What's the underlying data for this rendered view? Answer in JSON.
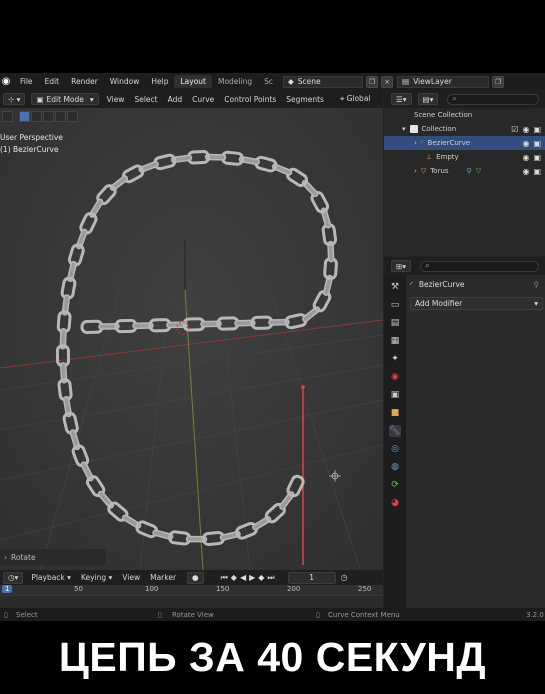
{
  "menubar": {
    "items": [
      "File",
      "Edit",
      "Render",
      "Window",
      "Help"
    ],
    "workspaces": [
      "Layout",
      "Modeling",
      "Sc"
    ],
    "scene": "Scene",
    "view_layer": "ViewLayer"
  },
  "viewport": {
    "mode": "Edit Mode",
    "menus": [
      "View",
      "Select",
      "Add",
      "Curve",
      "Control Points",
      "Segments"
    ],
    "transform_orientation": "Global",
    "perspective_label": "User Perspective",
    "object_label": "(1) BezierCurve",
    "last_operator": "Rotate"
  },
  "outliner": {
    "rows": [
      {
        "label": "Scene Collection",
        "selected": false
      },
      {
        "label": "Collection",
        "selected": false
      },
      {
        "label": "BezierCurve",
        "selected": true
      },
      {
        "label": "Empty",
        "selected": false
      },
      {
        "label": "Torus",
        "selected": false
      }
    ]
  },
  "properties": {
    "object_name": "BezierCurve",
    "add_modifier": "Add Modifier"
  },
  "timeline": {
    "menus": [
      "Playback",
      "Keying",
      "View",
      "Marker"
    ],
    "current_frame": "1",
    "ticks": [
      "1",
      "50",
      "100",
      "150",
      "200",
      "250"
    ]
  },
  "statusbar": {
    "select": "Select",
    "rotate_view": "Rotate View",
    "context_menu": "Curve Context Menu",
    "version": "3.2.0"
  },
  "caption": "ЦЕПЬ ЗА 40 СЕКУНД",
  "colors": {
    "selection": "#334d80",
    "active_frame": "#4772b3",
    "chain_link": "#b8b8b8",
    "red_line": "#e0443a"
  }
}
